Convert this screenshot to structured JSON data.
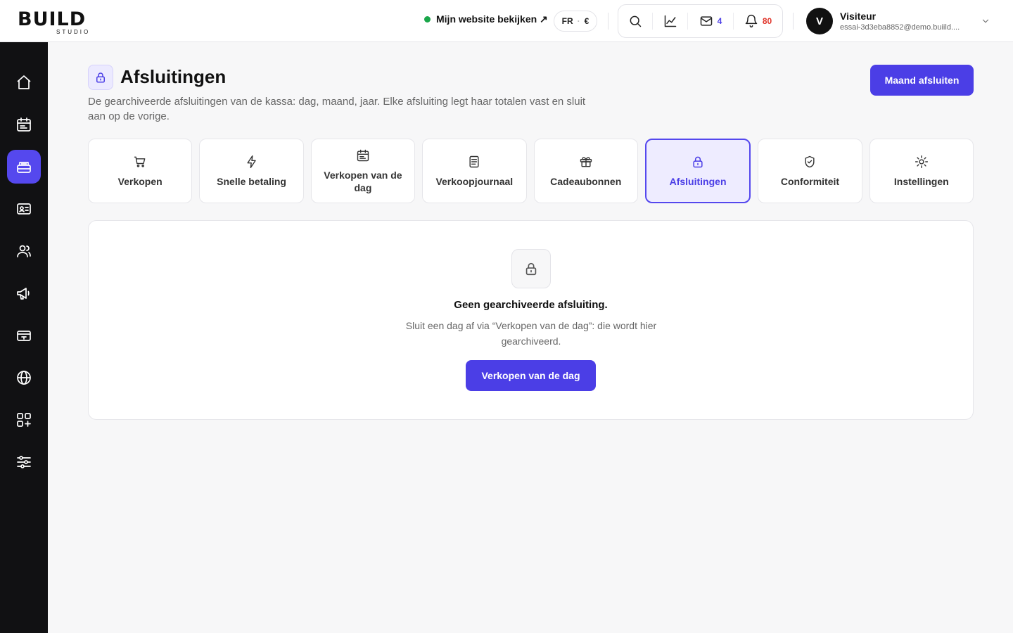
{
  "brand": {
    "logo_text": "BUILD",
    "logo_sub": "STUDIO",
    "accent": "#4b3ee6"
  },
  "header": {
    "site_link": "Mijn website bekijken ↗",
    "lang": "FR",
    "currency": "€",
    "mail_count": "4",
    "notif_count": "80",
    "user_initial": "V",
    "user_name": "Visiteur",
    "user_email": "essai-3d3eba8852@demo.buiild...."
  },
  "sidebar": {
    "items": [
      {
        "icon": "home-icon"
      },
      {
        "icon": "calendar-icon"
      },
      {
        "icon": "cash-register-icon",
        "active": true
      },
      {
        "icon": "id-card-icon"
      },
      {
        "icon": "users-icon"
      },
      {
        "icon": "megaphone-icon"
      },
      {
        "icon": "ticket-icon"
      },
      {
        "icon": "globe-icon"
      },
      {
        "icon": "apps-add-icon"
      },
      {
        "icon": "sliders-icon"
      }
    ]
  },
  "page": {
    "title": "Afsluitingen",
    "description": "De gearchiveerde afsluitingen van de kassa: dag, maand, jaar. Elke afsluiting legt haar totalen vast en sluit aan op de vorige.",
    "primary_button": "Maand afsluiten"
  },
  "tabs": [
    {
      "label": "Verkopen",
      "icon": "cart-icon"
    },
    {
      "label": "Snelle betaling",
      "icon": "lightning-icon"
    },
    {
      "label": "Verkopen van de dag",
      "icon": "calendar-icon"
    },
    {
      "label": "Verkoopjournaal",
      "icon": "document-icon"
    },
    {
      "label": "Cadeaubonnen",
      "icon": "gift-icon"
    },
    {
      "label": "Afsluitingen",
      "icon": "lock-icon",
      "active": true
    },
    {
      "label": "Conformiteit",
      "icon": "shield-check-icon"
    },
    {
      "label": "Instellingen",
      "icon": "sun-gear-icon"
    }
  ],
  "empty_state": {
    "title": "Geen gearchiveerde afsluiting.",
    "text": "Sluit een dag af via “Verkopen van de dag”: die wordt hier gearchiveerd.",
    "button": "Verkopen van de dag"
  }
}
